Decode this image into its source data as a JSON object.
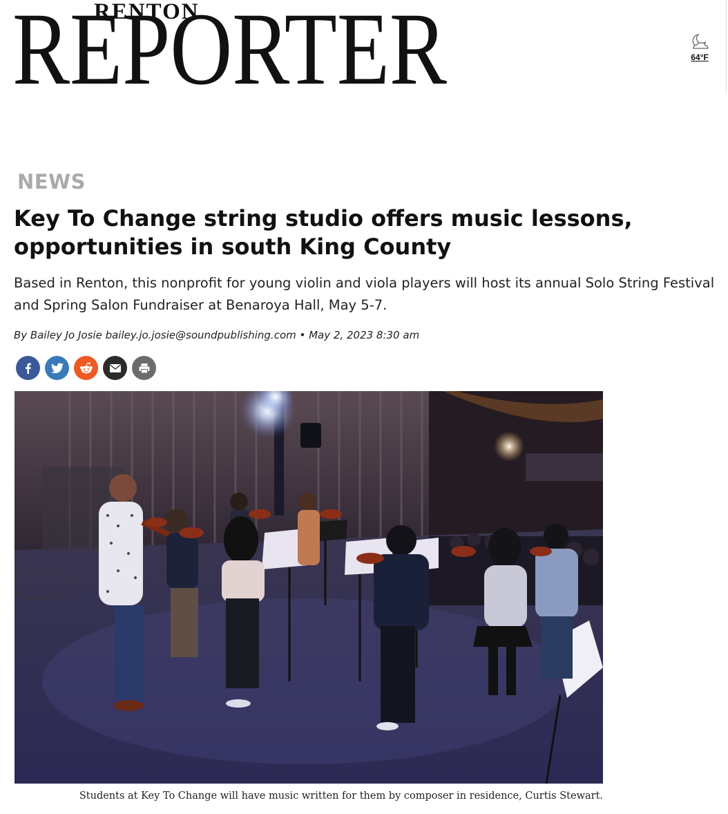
{
  "masthead": {
    "top_word": "RENTON",
    "main_word": "REPORTER"
  },
  "weather": {
    "icon": "moon-cloud-icon",
    "temperature": "64°F"
  },
  "article": {
    "section": "NEWS",
    "headline": "Key To Change string studio offers music lessons, opportunities in south King County",
    "dek": "Based in Renton, this nonprofit for young violin and viola players will host its annual Solo String Festival and Spring Salon Fundraiser at Benaroya Hall, May 5-7.",
    "byline": "By Bailey Jo Josie bailey.jo.josie@soundpublishing.com • May 2, 2023 8:30 am",
    "caption": "Students at Key To Change will have music written for them by composer in residence, Curtis Stewart."
  },
  "share": [
    {
      "icon": "facebook-icon",
      "color": "#3b5998"
    },
    {
      "icon": "twitter-icon",
      "color": "#3a7ab8"
    },
    {
      "icon": "reddit-icon",
      "color": "#ee5a22"
    },
    {
      "icon": "email-icon",
      "color": "#2b2b2b"
    },
    {
      "icon": "print-icon",
      "color": "#6b6b6b"
    }
  ],
  "colors": {
    "section_label": "#aaaaaa",
    "text": "#111111"
  }
}
